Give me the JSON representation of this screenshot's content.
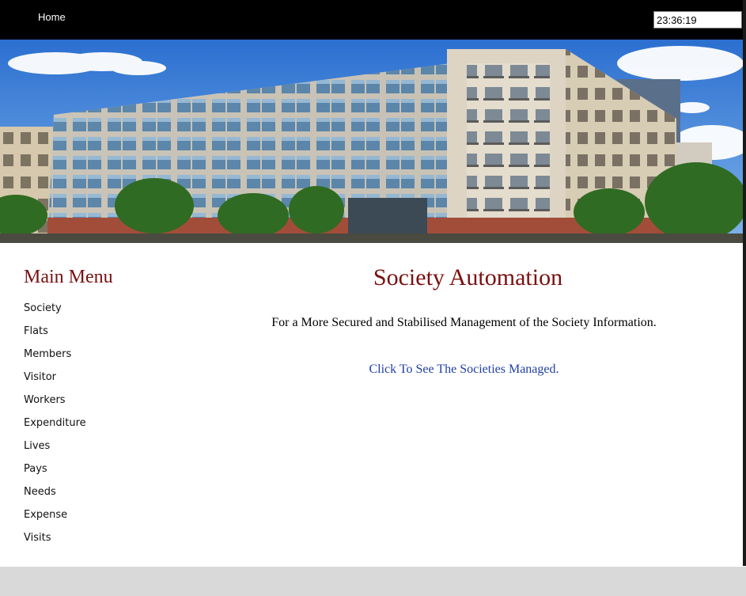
{
  "nav": {
    "home_label": "Home",
    "clock_value": "23:36:19"
  },
  "menu": {
    "title": "Main Menu",
    "items": [
      "Society",
      "Flats",
      "Members",
      "Visitor",
      "Workers",
      "Expenditure",
      "Lives",
      "Pays",
      "Needs",
      "Expense",
      "Visits"
    ]
  },
  "main": {
    "title": "Society Automation",
    "tagline": "For a More Secured and Stabilised Management of the Society Information.",
    "link_label": "Click To See The Societies Managed."
  },
  "colors": {
    "title": "#7a1010",
    "link": "#1f3fa6",
    "footer": "#d9d9d9"
  }
}
